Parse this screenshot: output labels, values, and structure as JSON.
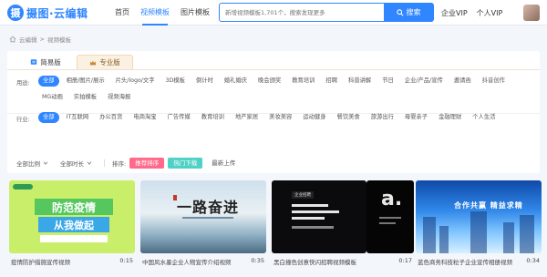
{
  "brand": {
    "name": "摄图·云编辑",
    "mark": "摄"
  },
  "nav": {
    "items": [
      "首页",
      "视频模板",
      "图片模板"
    ],
    "active_index": 1
  },
  "search": {
    "placeholder": "新增视频模板1,701个，搜索发现更多",
    "button_label": "搜索"
  },
  "top_links": {
    "enterprise_vip": "企业VIP",
    "personal_vip": "个人VIP"
  },
  "breadcrumb": [
    "云编辑",
    "视频模板"
  ],
  "tabs": {
    "simple": "简易版",
    "pro": "专业版"
  },
  "usage": {
    "label": "用途:",
    "items": [
      "全部",
      "相册/图片/展示",
      "片头/logo/文字",
      "3D模板",
      "倒计时",
      "婚礼婚庆",
      "晚会颁奖",
      "教育培训",
      "招聘",
      "科普讲解",
      "节日",
      "企业/产品/宣传",
      "邀请函",
      "抖音创作",
      "MG动画",
      "实拍模板",
      "视频海报"
    ],
    "active_index": 0
  },
  "industry": {
    "label": "行业:",
    "items": [
      "全部",
      "IT互联网",
      "办公百货",
      "电商淘宝",
      "广告传媒",
      "教育培训",
      "地产家居",
      "美妆美容",
      "运动健身",
      "餐饮美食",
      "旅游出行",
      "母婴亲子",
      "金融理财",
      "个人生活"
    ],
    "active_index": 0
  },
  "filters": {
    "ratio": "全部比例",
    "duration": "全部时长",
    "sort_label": "排序:",
    "sort_options": [
      "推荐排序",
      "热门下载",
      "最新上传"
    ]
  },
  "cards": [
    {
      "title": "疫情防护措施宣传视频",
      "duration": "0:15",
      "thumb": {
        "line1": "防范疫情",
        "line2": "从我做起"
      }
    },
    {
      "title": "中国风水墨企业人物宣传介绍视频",
      "duration": "0:35",
      "thumb": {
        "calligraphy": "一路奋进"
      }
    },
    {
      "title": "黑白撞色创意快闪招聘视频模板",
      "duration": "0:17",
      "thumb": {
        "tag": "企业招聘"
      }
    },
    {
      "title": "",
      "duration": "0:17",
      "thumb": {
        "big": "a."
      }
    },
    {
      "title": "蓝色商务科技粒子企业宣传相册视频",
      "duration": "0:34",
      "thumb": {
        "title": "合作共赢 精益求精"
      }
    }
  ],
  "colors": {
    "accent": "#2f86ff",
    "sort_primary": "#ff6a8a",
    "sort_hot": "#4fd1c5",
    "pro_tab": "#fbf1e3"
  }
}
